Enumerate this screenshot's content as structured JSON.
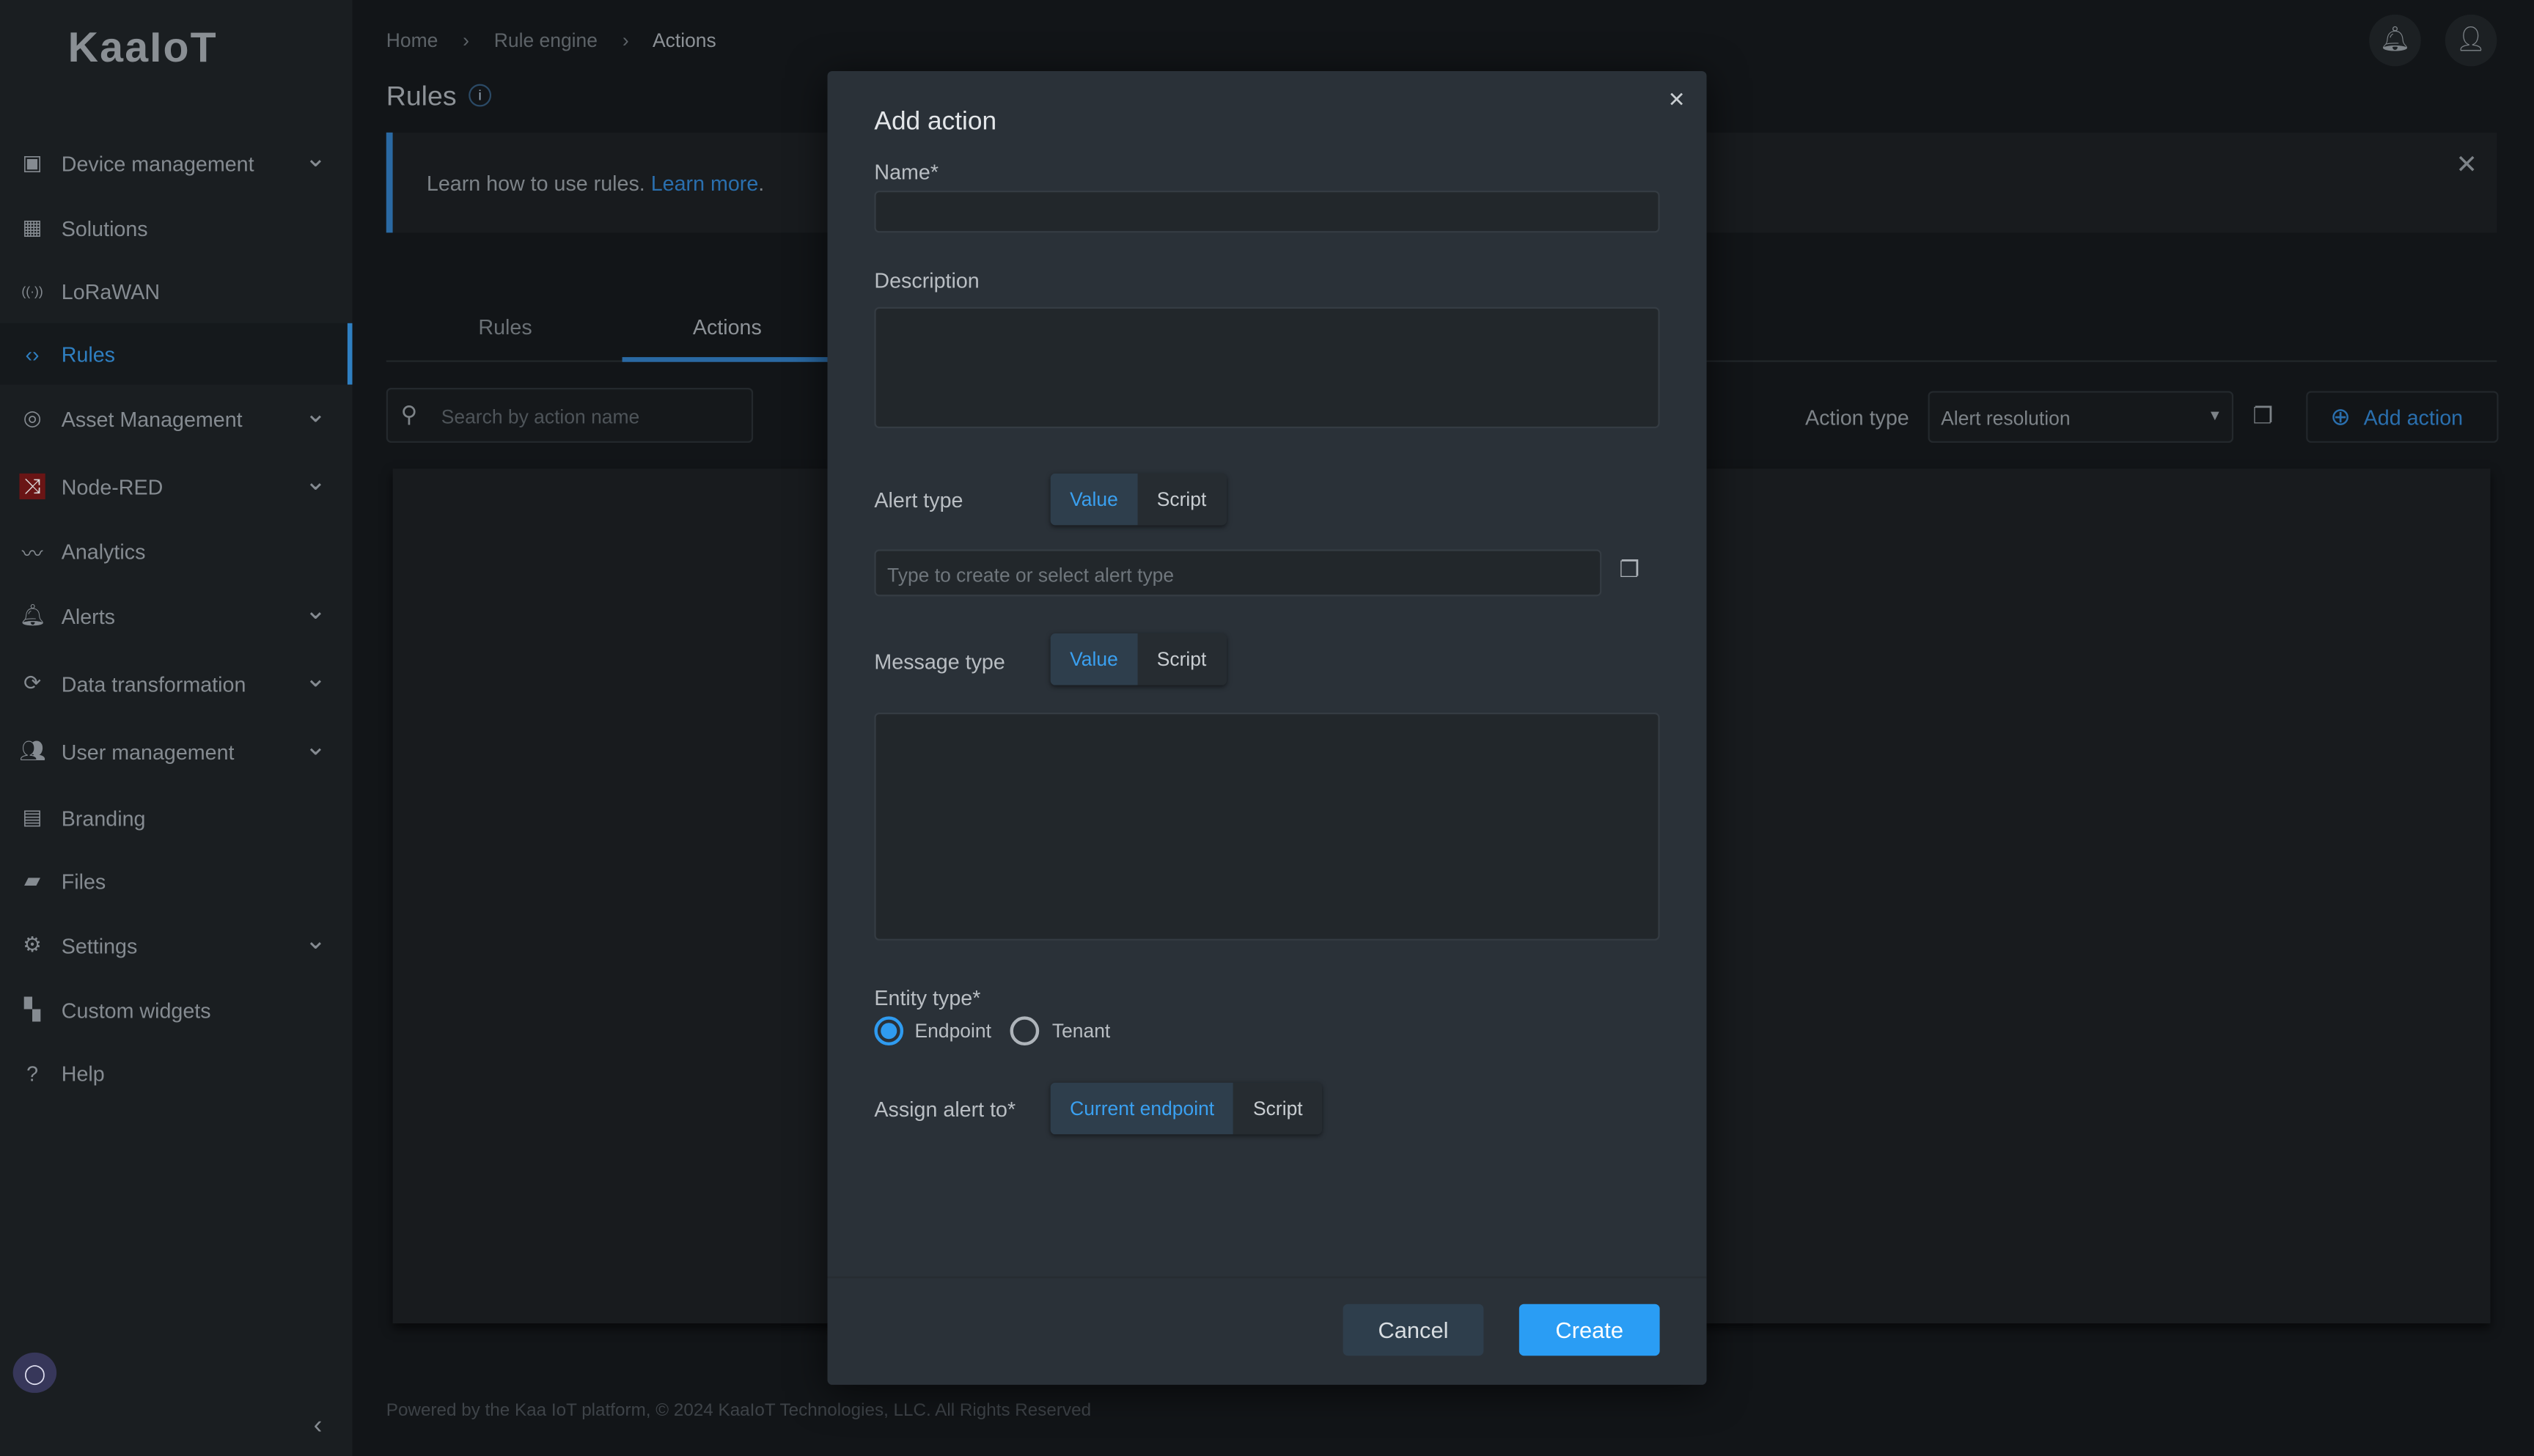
{
  "brand": {
    "logo": "KaaIoT"
  },
  "sidebar": {
    "items": [
      {
        "label": "Device management",
        "icon": "device-icon",
        "chevron": true
      },
      {
        "label": "Solutions",
        "icon": "grid-icon",
        "chevron": false
      },
      {
        "label": "LoRaWAN",
        "icon": "antenna-icon",
        "chevron": false
      },
      {
        "label": "Rules",
        "icon": "code-icon",
        "chevron": false,
        "active": true
      },
      {
        "label": "Asset Management",
        "icon": "asset-icon",
        "chevron": true
      },
      {
        "label": "Node-RED",
        "icon": "node-red-icon",
        "chevron": true
      },
      {
        "label": "Analytics",
        "icon": "analytics-icon",
        "chevron": false
      },
      {
        "label": "Alerts",
        "icon": "bell-icon",
        "chevron": true
      },
      {
        "label": "Data transformation",
        "icon": "transform-icon",
        "chevron": true
      },
      {
        "label": "User management",
        "icon": "users-icon",
        "chevron": true
      },
      {
        "label": "Branding",
        "icon": "branding-icon",
        "chevron": false
      },
      {
        "label": "Files",
        "icon": "folder-icon",
        "chevron": false
      },
      {
        "label": "Settings",
        "icon": "gear-icon",
        "chevron": true
      },
      {
        "label": "Custom widgets",
        "icon": "widgets-icon",
        "chevron": false
      },
      {
        "label": "Help",
        "icon": "help-icon",
        "chevron": false
      }
    ],
    "collapse": "‹"
  },
  "breadcrumb": [
    "Home",
    "Rule engine",
    "Actions"
  ],
  "page": {
    "title": "Rules",
    "banner_text": "Learn how to use rules.",
    "banner_link": "Learn more",
    "banner_suffix": "."
  },
  "tabs": [
    {
      "label": "Rules"
    },
    {
      "label": "Actions",
      "active": true
    }
  ],
  "search": {
    "placeholder": "Search by action name"
  },
  "filter": {
    "label": "Action type",
    "value": "Alert resolution"
  },
  "add_action_label": "Add action",
  "footer": "Powered by the Kaa IoT platform, © 2024 KaaIoT Technologies, LLC. All Rights Reserved",
  "modal": {
    "title": "Add action",
    "name_label": "Name*",
    "name_value": "",
    "description_label": "Description",
    "description_value": "",
    "alert_type_label": "Alert type",
    "alert_type_options": [
      "Value",
      "Script"
    ],
    "alert_type_placeholder": "Type to create or select alert type",
    "message_type_label": "Message type",
    "message_type_options": [
      "Value",
      "Script"
    ],
    "entity_type_label": "Entity type*",
    "entity_options": [
      "Endpoint",
      "Tenant"
    ],
    "entity_selected": "Endpoint",
    "assign_label": "Assign alert to*",
    "assign_options": [
      "Current endpoint",
      "Script"
    ],
    "cancel": "Cancel",
    "create": "Create"
  },
  "colors": {
    "accent": "#2f9bf0",
    "create_button": "#2a9df4",
    "cancel_button": "#2e3e4c"
  }
}
